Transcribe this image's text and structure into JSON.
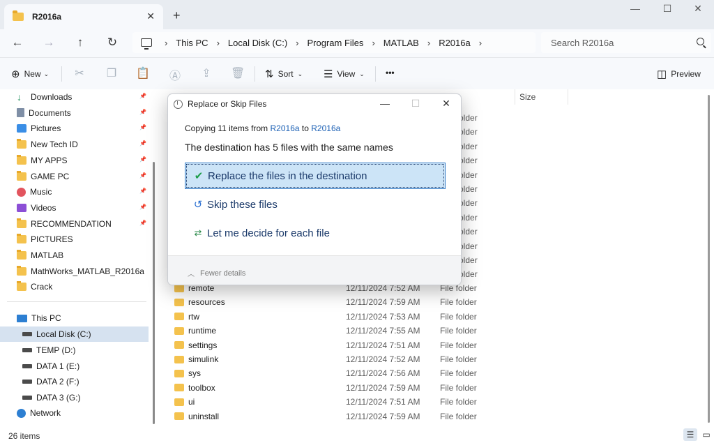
{
  "window": {
    "tab_title": "R2016a",
    "tab_close": "✕",
    "new_tab": "+",
    "minimize": "—",
    "maximize": "☐",
    "close": "✕"
  },
  "nav": {
    "back": "←",
    "forward": "→",
    "up": "↑",
    "refresh": "↻"
  },
  "breadcrumb": [
    "This PC",
    "Local Disk (C:)",
    "Program Files",
    "MATLAB",
    "R2016a"
  ],
  "breadcrumb_sep": "›",
  "search": {
    "placeholder": "Search R2016a"
  },
  "toolbar": {
    "new_label": "New",
    "sort_label": "Sort",
    "view_label": "View",
    "more_label": "•••",
    "preview_label": "Preview"
  },
  "sidebar": {
    "quick": [
      {
        "label": "Downloads",
        "icon": "download-icon"
      },
      {
        "label": "Documents",
        "icon": "documents-icon"
      },
      {
        "label": "Pictures",
        "icon": "pictures-icon"
      },
      {
        "label": "New Tech ID",
        "icon": "folder-icon"
      },
      {
        "label": "MY APPS",
        "icon": "folder-icon"
      },
      {
        "label": "GAME PC",
        "icon": "folder-icon"
      },
      {
        "label": "Music",
        "icon": "music-icon"
      },
      {
        "label": "Videos",
        "icon": "videos-icon"
      },
      {
        "label": "RECOMMENDATION",
        "icon": "folder-icon"
      },
      {
        "label": "PICTURES",
        "icon": "folder-icon"
      },
      {
        "label": "MATLAB",
        "icon": "folder-icon"
      },
      {
        "label": "MathWorks_MATLAB_R2016a",
        "icon": "folder-icon"
      },
      {
        "label": "Crack",
        "icon": "folder-icon"
      }
    ],
    "this_pc": "This PC",
    "drives": [
      "Local Disk (C:)",
      "TEMP (D:)",
      "DATA 1 (E:)",
      "DATA 2 (F:)",
      "DATA 3 (G:)"
    ],
    "network": "Network"
  },
  "filelist": {
    "columns": {
      "size": "Size"
    },
    "partial_type": "File folder",
    "rows": [
      {
        "name": "remote",
        "date": "12/11/2024 7:52 AM",
        "type": "File folder"
      },
      {
        "name": "resources",
        "date": "12/11/2024 7:59 AM",
        "type": "File folder"
      },
      {
        "name": "rtw",
        "date": "12/11/2024 7:53 AM",
        "type": "File folder"
      },
      {
        "name": "runtime",
        "date": "12/11/2024 7:55 AM",
        "type": "File folder"
      },
      {
        "name": "settings",
        "date": "12/11/2024 7:51 AM",
        "type": "File folder"
      },
      {
        "name": "simulink",
        "date": "12/11/2024 7:52 AM",
        "type": "File folder"
      },
      {
        "name": "sys",
        "date": "12/11/2024 7:56 AM",
        "type": "File folder"
      },
      {
        "name": "toolbox",
        "date": "12/11/2024 7:59 AM",
        "type": "File folder"
      },
      {
        "name": "ui",
        "date": "12/11/2024 7:51 AM",
        "type": "File folder"
      },
      {
        "name": "uninstall",
        "date": "12/11/2024 7:59 AM",
        "type": "File folder"
      }
    ]
  },
  "status": {
    "count": "26 items"
  },
  "dialog": {
    "title": "Replace or Skip Files",
    "copying_prefix": "Copying 11 items from",
    "copy_from": "R2016a",
    "copy_to_word": "to",
    "copy_to": "R2016a",
    "heading": "The destination has 5 files with the same names",
    "option_replace": "Replace the files in the destination",
    "option_skip": "Skip these files",
    "option_decide": "Let me decide for each file",
    "fewer_details": "Fewer details"
  }
}
